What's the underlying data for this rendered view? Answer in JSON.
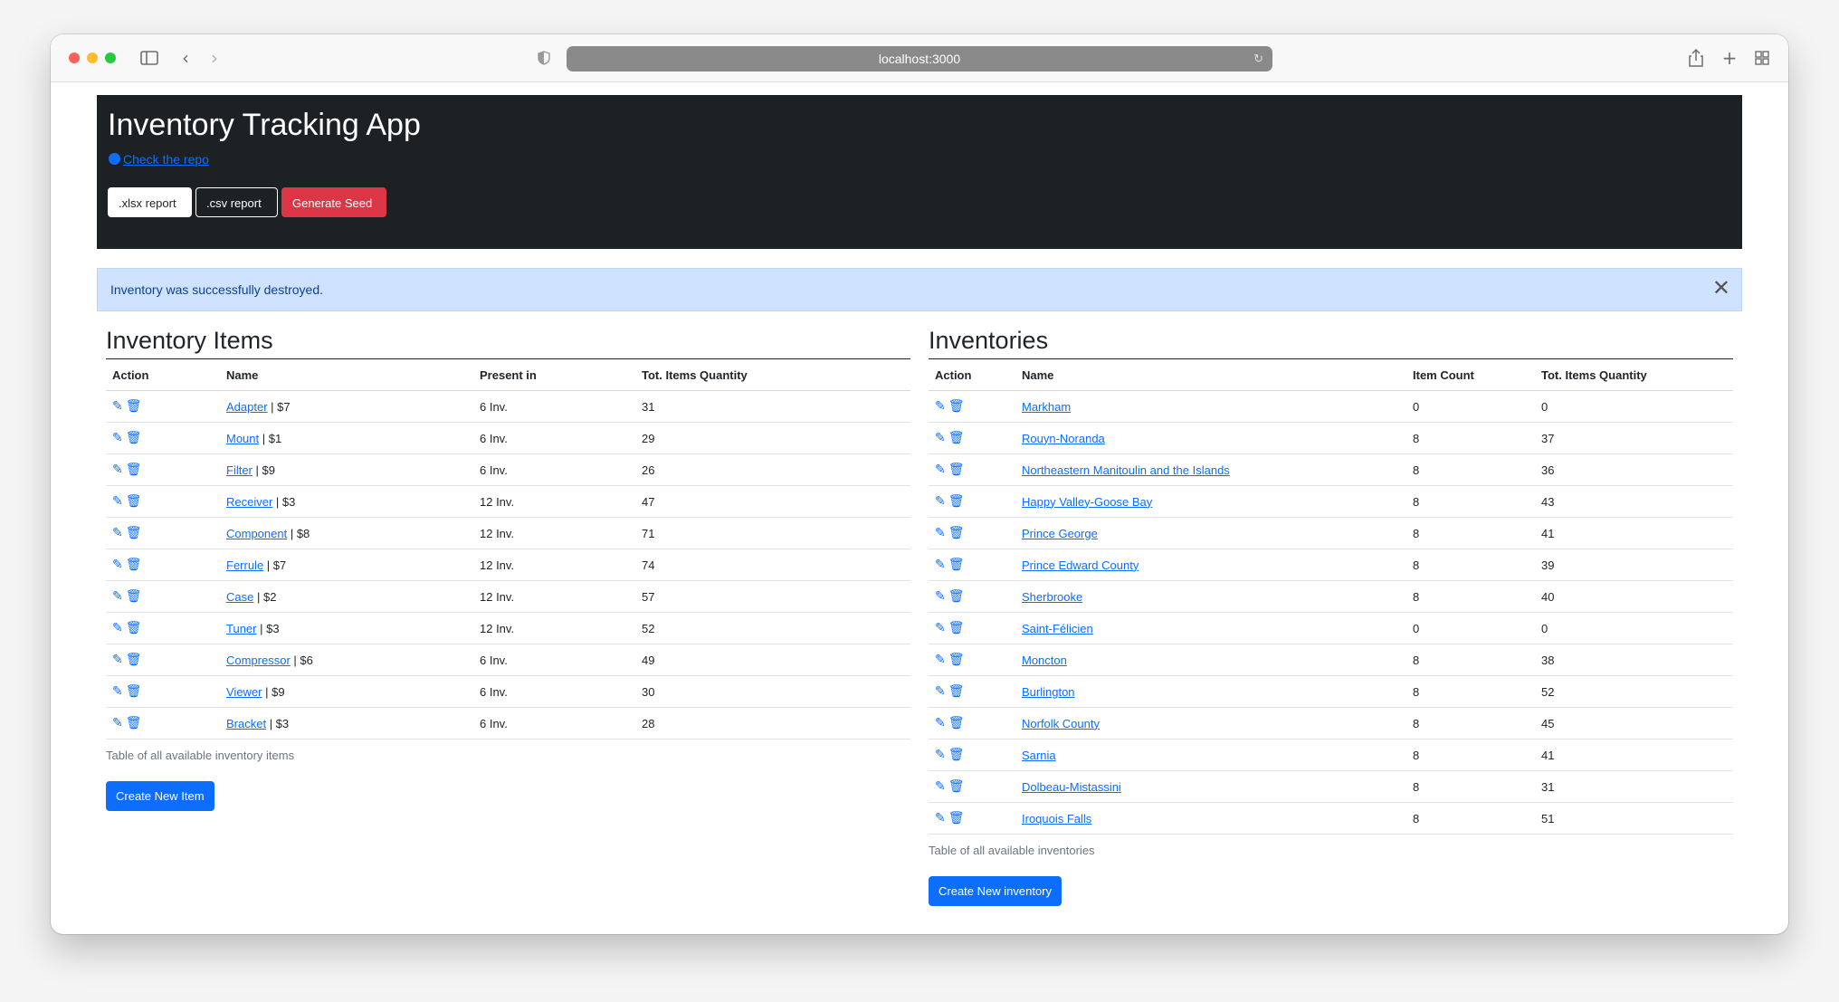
{
  "browser": {
    "url": "localhost:3000",
    "icons": [
      "sidebar-icon",
      "back-icon",
      "forward-icon",
      "shield-icon",
      "translate-icon",
      "reload-icon",
      "share-icon",
      "new-tab-icon",
      "tabs-overview-icon"
    ]
  },
  "header": {
    "title": "Inventory Tracking App",
    "repo_link": "Check the repo",
    "xlsx_button": ".xlsx report",
    "csv_button": ".csv report",
    "seed_button": "Generate Seed"
  },
  "alert": {
    "message": "Inventory was successfully destroyed.",
    "close": "✕"
  },
  "items_section": {
    "title": "Inventory Items",
    "columns": [
      "Action",
      "Name",
      "Present in",
      "Tot. Items Quantity"
    ],
    "rows": [
      {
        "name": "Adapter",
        "price": " | $7",
        "present": "6 Inv.",
        "qty": "31"
      },
      {
        "name": "Mount",
        "price": " | $1",
        "present": "6 Inv.",
        "qty": "29"
      },
      {
        "name": "Filter",
        "price": " | $9",
        "present": "6 Inv.",
        "qty": "26"
      },
      {
        "name": "Receiver",
        "price": " | $3",
        "present": "12 Inv.",
        "qty": "47"
      },
      {
        "name": "Component",
        "price": " | $8",
        "present": "12 Inv.",
        "qty": "71"
      },
      {
        "name": "Ferrule",
        "price": " | $7",
        "present": "12 Inv.",
        "qty": "74"
      },
      {
        "name": "Case",
        "price": " | $2",
        "present": "12 Inv.",
        "qty": "57"
      },
      {
        "name": "Tuner",
        "price": " | $3",
        "present": "12 Inv.",
        "qty": "52"
      },
      {
        "name": "Compressor",
        "price": " | $6",
        "present": "6 Inv.",
        "qty": "49"
      },
      {
        "name": "Viewer",
        "price": " | $9",
        "present": "6 Inv.",
        "qty": "30"
      },
      {
        "name": "Bracket",
        "price": " | $3",
        "present": "6 Inv.",
        "qty": "28"
      }
    ],
    "caption": "Table of all available inventory items",
    "create_button": "Create New Item"
  },
  "inventories_section": {
    "title": "Inventories",
    "columns": [
      "Action",
      "Name",
      "Item Count",
      "Tot. Items Quantity"
    ],
    "rows": [
      {
        "name": "Markham",
        "count": "0",
        "qty": "0"
      },
      {
        "name": "Rouyn-Noranda",
        "count": "8",
        "qty": "37"
      },
      {
        "name": "Northeastern Manitoulin and the Islands",
        "count": "8",
        "qty": "36"
      },
      {
        "name": "Happy Valley-Goose Bay",
        "count": "8",
        "qty": "43"
      },
      {
        "name": "Prince George",
        "count": "8",
        "qty": "41"
      },
      {
        "name": "Prince Edward County",
        "count": "8",
        "qty": "39"
      },
      {
        "name": "Sherbrooke",
        "count": "8",
        "qty": "40"
      },
      {
        "name": "Saint-Félicien",
        "count": "0",
        "qty": "0"
      },
      {
        "name": "Moncton",
        "count": "8",
        "qty": "38"
      },
      {
        "name": "Burlington",
        "count": "8",
        "qty": "52"
      },
      {
        "name": "Norfolk County",
        "count": "8",
        "qty": "45"
      },
      {
        "name": "Sarnia",
        "count": "8",
        "qty": "41"
      },
      {
        "name": "Dolbeau-Mistassini",
        "count": "8",
        "qty": "31"
      },
      {
        "name": "Iroquois Falls",
        "count": "8",
        "qty": "51"
      }
    ],
    "caption": "Table of all available inventories",
    "create_button": "Create New inventory"
  },
  "colors": {
    "primary": "#0d6efd",
    "danger": "#dc3545",
    "header_bg": "#1e2124",
    "alert_bg": "#cfe2ff"
  }
}
